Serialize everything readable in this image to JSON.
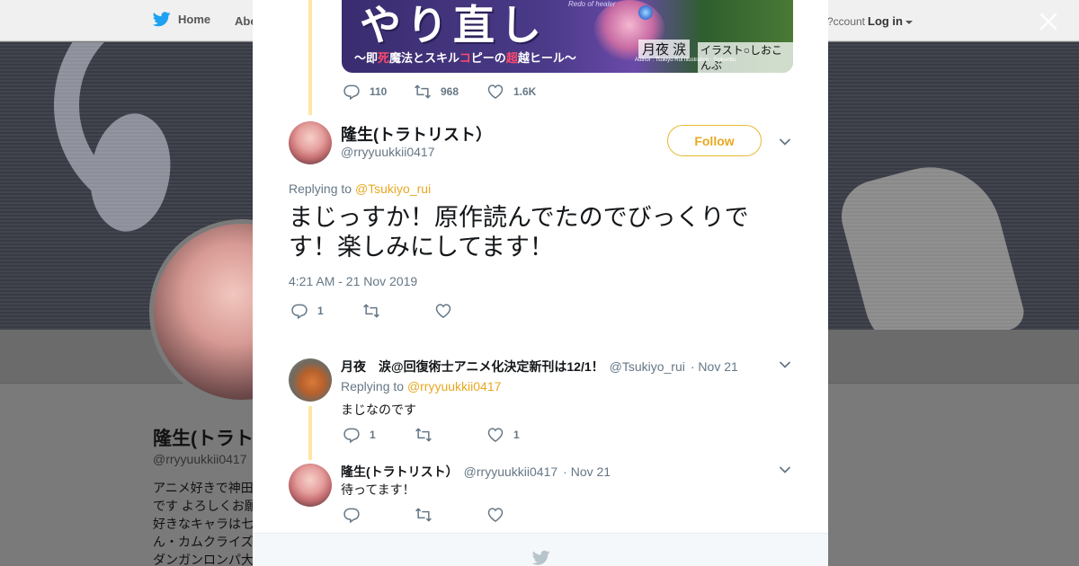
{
  "topbar": {
    "home_label": "Home",
    "about_label": "Abo",
    "account_question": "ccount?",
    "login_label": "Log in"
  },
  "profile": {
    "name": "隆生(トラト",
    "handle": "@rryyuukkii0417",
    "bio": "アニメ好きで神田\nです よろしくお願\n好きなキャラは七\nん・カムクライズ\nダンガンロンパ大"
  },
  "cover": {
    "title": "やり直し",
    "latin_title": "Redo of healer",
    "subtitle_pre": "〜即",
    "subtitle_red1": "死",
    "subtitle_mid": "魔法とスキル",
    "subtitle_red2": "コ",
    "subtitle_mid2": "ピーの",
    "subtitle_red3": "超",
    "subtitle_post": "越ヒール〜",
    "author": "月夜 涙",
    "illustrator": "イラスト○しおこんぶ",
    "author_latin": "Author : Tsukiyo Rui   Illustration : Siokonbu"
  },
  "prev_tweet_actions": {
    "replies": "110",
    "retweets": "968",
    "likes": "1.6K"
  },
  "main_tweet": {
    "name": "隆生(トラトリスト）",
    "handle": "@rryyuukkii0417",
    "follow_label": "Follow",
    "replying_prefix": "Replying to",
    "replying_mention": "@Tsukiyo_rui",
    "text": "まじっすか！原作読んでたのでびっくりです！楽しみにしてます！",
    "timestamp": "4:21 AM - 21 Nov 2019",
    "replies": "1",
    "retweets": "",
    "likes": ""
  },
  "replies": [
    {
      "name": "月夜　涙@回復術士アニメ化決定新刊は12/1！",
      "handle": "@Tsukiyo_rui",
      "date": "· Nov 21",
      "replying_prefix": "Replying to",
      "replying_mention": "@rryyuukkii0417",
      "text": "まじなのです",
      "replies": "1",
      "retweets": "",
      "likes": "1"
    },
    {
      "name": "隆生(トラトリスト）",
      "handle": "@rryyuukkii0417",
      "date": "· Nov 21",
      "text": "待ってます！",
      "replies": "",
      "retweets": "",
      "likes": ""
    }
  ],
  "colors": {
    "accent": "#e8a820",
    "thread_line": "#fde7a3",
    "text_primary": "#14171a",
    "text_secondary": "#657786",
    "twitter_blue": "#1da1f2"
  },
  "icons": {
    "reply": "reply-icon",
    "retweet": "retweet-icon",
    "like": "heart-icon",
    "close": "close-icon",
    "chevron": "chevron-down-icon",
    "bird": "twitter-bird-icon"
  }
}
